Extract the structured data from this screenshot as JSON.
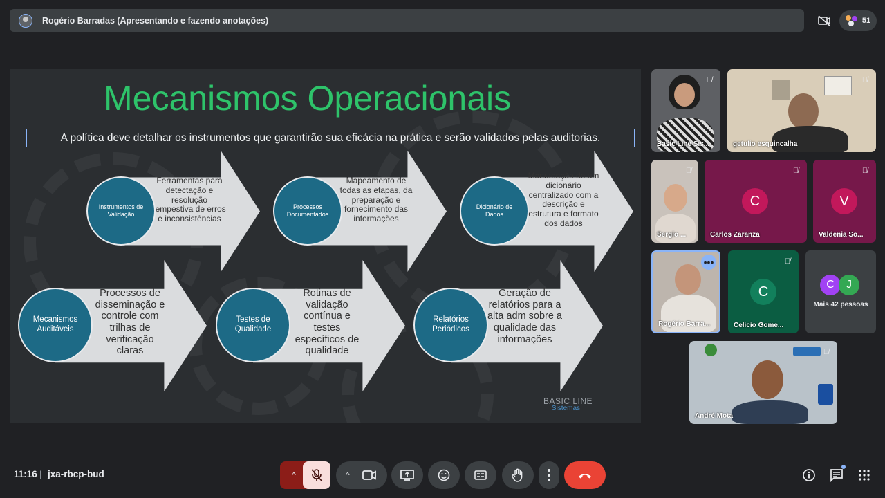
{
  "presenter_bar": {
    "title": "Rogério Barradas (Apresentando e fazendo anotações)",
    "participant_count": "51"
  },
  "slide": {
    "title": "Mecanismos Operacionais",
    "subtitle": "A política deve detalhar os instrumentos que garantirão sua eficácia na prática e serão validados pelas auditorias.",
    "items": [
      {
        "circle": "Instrumentos de Validação",
        "text": "Ferramentas para detectação e resolução tempestiva de erros e inconsistências"
      },
      {
        "circle": "Processos Documentados",
        "text": "Mapeamento de todas as etapas, da preparação e fornecimento das informações"
      },
      {
        "circle": "Dicionário de Dados",
        "text": "Manutenção de um dicionário centralizado com a descrição e estrutura e formato dos dados"
      },
      {
        "circle": "Mecanismos Auditáveis",
        "text": "Processos de disseminação e controle com trilhas de verificação claras"
      },
      {
        "circle": "Testes de Qualidade",
        "text": "Rotinas de validação contínua e testes específicos de qualidade"
      },
      {
        "circle": "Relatórios Periódicos",
        "text": "Geração de relatórios para a alta adm sobre a qualidade das informações"
      }
    ],
    "logo_main": "BASIC LINE",
    "logo_sub": "Sistemas"
  },
  "participants": [
    {
      "name": "Basic Line Sis..."
    },
    {
      "name": "getulio esquincalha"
    },
    {
      "name": "Sergio ..."
    },
    {
      "name": "Carlos Zaranza",
      "initial": "C",
      "color": "#9c1f5f"
    },
    {
      "name": "Valdenia So...",
      "initial": "V",
      "color": "#9c1f5f"
    },
    {
      "name": "Rogério Barra..."
    },
    {
      "name": "Celicio Gome...",
      "initial": "C",
      "color": "#12805c"
    },
    {
      "name": "Mais 42 pessoas",
      "initials": [
        "C",
        "J"
      ]
    },
    {
      "name": "André Mota"
    }
  ],
  "bottom": {
    "time": "11:16",
    "separator": "|",
    "meeting_code": "jxa-rbcp-bud"
  },
  "colors": {
    "end_call": "#ea4335",
    "mic_off": "#f9dedc",
    "mic_off_arrow": "#8c1d18",
    "accent": "#2ec36a",
    "circle": "#1d6a86"
  }
}
